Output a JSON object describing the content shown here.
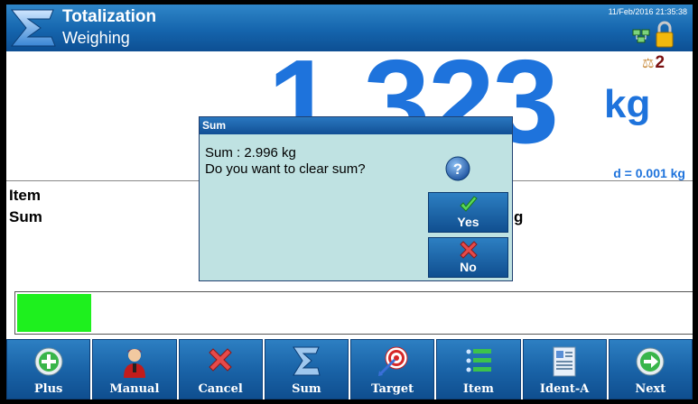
{
  "header": {
    "title": "Totalization",
    "subtitle": "Weighing",
    "datetime": "11/Feb/2016 21:35:38",
    "logo_icon": "sigma-icon",
    "status_icons": [
      "network-icon",
      "lock-icon"
    ]
  },
  "display": {
    "weight": "1.323",
    "unit": "kg",
    "scale_number": "2",
    "division": "d = 0.001 kg"
  },
  "info": {
    "item_label": "Item",
    "sum_label": "Sum",
    "sum_unit_tail": "g"
  },
  "progress": {
    "value": 0.11,
    "color": "#1ef01e"
  },
  "dialog": {
    "title": "Sum",
    "message_line1": "Sum : 2.996 kg",
    "message_line2": "Do you want to clear sum?",
    "icon": "question-icon",
    "yes_label": "Yes",
    "no_label": "No"
  },
  "softkeys": [
    {
      "label": "Plus",
      "icon": "plus-icon"
    },
    {
      "label": "Manual",
      "icon": "operator-icon"
    },
    {
      "label": "Cancel",
      "icon": "cancel-x-icon"
    },
    {
      "label": "Sum",
      "icon": "sigma-icon"
    },
    {
      "label": "Target",
      "icon": "target-icon"
    },
    {
      "label": "Item",
      "icon": "list-icon"
    },
    {
      "label": "Ident-A",
      "icon": "document-icon"
    },
    {
      "label": "Next",
      "icon": "arrow-right-icon"
    }
  ],
  "colors": {
    "accent": "#1e73dc",
    "header": "#1565ad",
    "dialog_bg": "#bfe2e2"
  }
}
